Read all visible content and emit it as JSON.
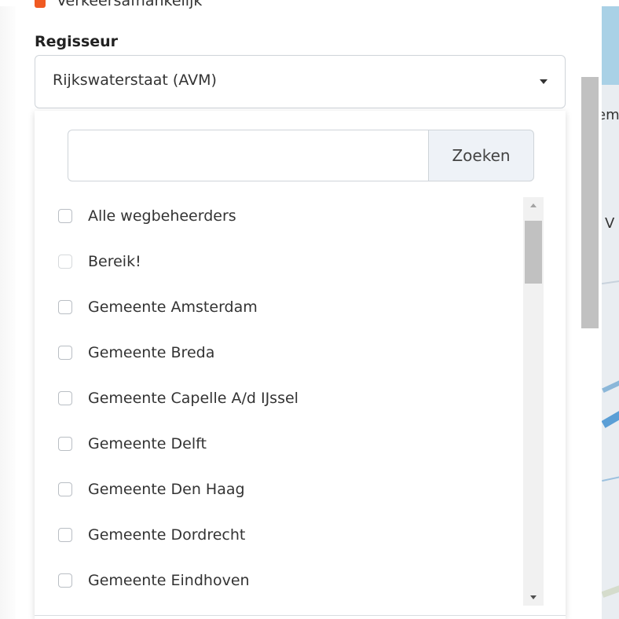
{
  "top_checkbox": {
    "label": "Verkeersafhankelijk",
    "color": "#f05a22"
  },
  "regisseur": {
    "label": "Regisseur",
    "selected": "Rijkswaterstaat (AVM)"
  },
  "dropdown": {
    "search_placeholder": "",
    "search_button": "Zoeken",
    "options": [
      {
        "label": "Alle wegbeheerders",
        "checked": false
      },
      {
        "label": "Bereik!",
        "checked": false
      },
      {
        "label": "Gemeente Amsterdam",
        "checked": false
      },
      {
        "label": "Gemeente Breda",
        "checked": false
      },
      {
        "label": "Gemeente Capelle A/d IJssel",
        "checked": false
      },
      {
        "label": "Gemeente Delft",
        "checked": false
      },
      {
        "label": "Gemeente Den Haag",
        "checked": false
      },
      {
        "label": "Gemeente Dordrecht",
        "checked": false
      },
      {
        "label": "Gemeente Eindhoven",
        "checked": false
      }
    ]
  },
  "map": {
    "labels": [
      "em",
      "V"
    ]
  }
}
